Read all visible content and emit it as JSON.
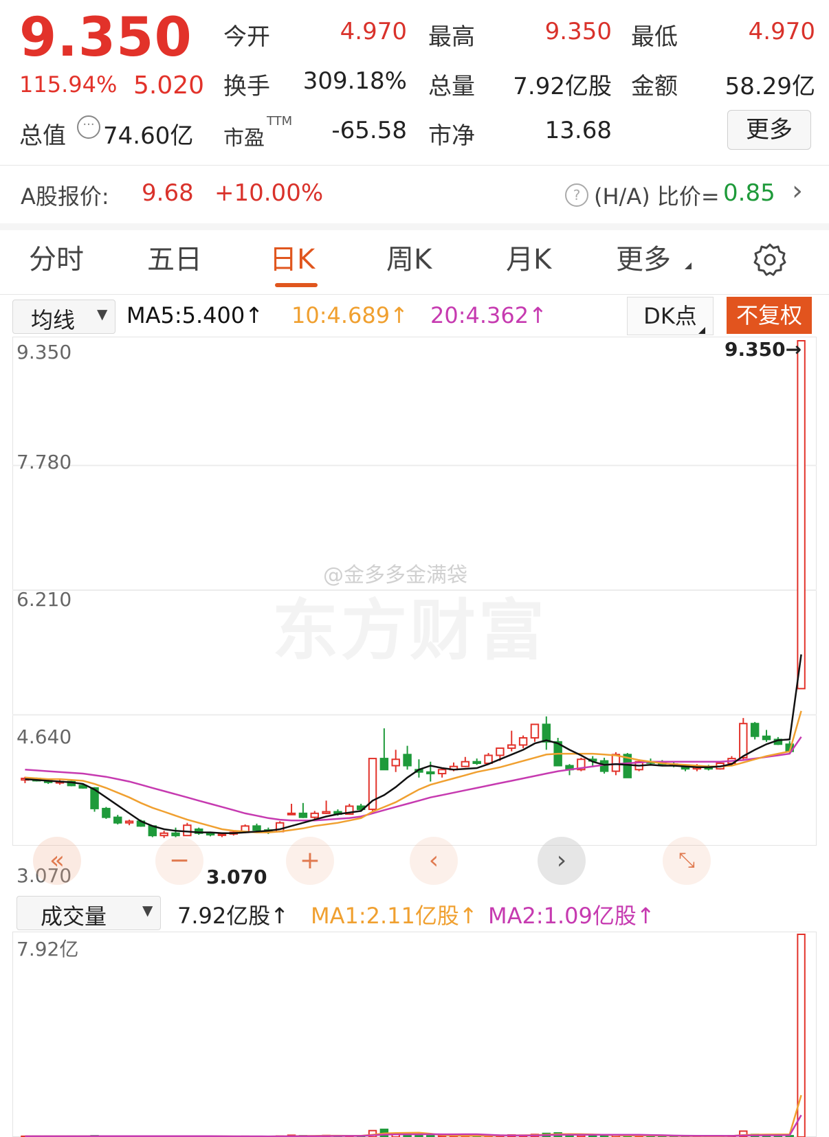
{
  "quote": {
    "price": "9.350",
    "change_pct": "115.94%",
    "change_abs": "5.020",
    "open_label": "今开",
    "open_value": "4.970",
    "high_label": "最高",
    "high_value": "9.350",
    "low_label": "最低",
    "low_value": "4.970",
    "turnover_label": "换手",
    "turnover_value": "309.18%",
    "volume_label": "总量",
    "volume_value": "7.92亿股",
    "amount_label": "金额",
    "amount_value": "58.29亿",
    "mktcap_label": "总值",
    "mktcap_value": "74.60亿",
    "pe_label": "市盈",
    "pe_sup": "TTM",
    "pe_value": "-65.58",
    "pb_label": "市净",
    "pb_value": "13.68",
    "more_label": "更多"
  },
  "ashare": {
    "label": "A股报价:",
    "price": "9.68",
    "change": "+10.00%",
    "ratio_label": "(H/A) 比价=",
    "ratio_value": "0.85"
  },
  "tabs": [
    {
      "label": "分时"
    },
    {
      "label": "五日"
    },
    {
      "label": "日K"
    },
    {
      "label": "周K"
    },
    {
      "label": "月K"
    },
    {
      "label": "更多"
    }
  ],
  "active_tab": "日K",
  "ma_bar": {
    "selector": "均线",
    "ma5": "MA5:5.400↑",
    "ma10": "10:4.689↑",
    "ma20": "20:4.362↑",
    "dk_label": "DK点",
    "adjust_label": "不复权"
  },
  "price_axis": [
    "9.350",
    "7.780",
    "6.210",
    "4.640",
    "3.070"
  ],
  "last_price_marker": "9.350→",
  "min_price_marker": "3.070",
  "watermark": {
    "weibo": "@金多多金满袋",
    "brand": "东方财富"
  },
  "volume_bar": {
    "selector": "成交量",
    "total": "7.92亿股↑",
    "ma1": "MA1:2.11亿股↑",
    "ma2": "MA2:1.09亿股↑",
    "axis_top": "7.92亿"
  },
  "colors": {
    "up": "#e2322a",
    "down": "#1e9a3a",
    "ma5": "#111111",
    "ma10": "#f0a030",
    "ma20": "#c63ab0",
    "accent": "#e0561e"
  },
  "chart_data": {
    "type": "candlestick",
    "ylim": [
      3.07,
      9.35
    ],
    "candles": [
      [
        3.82,
        3.86,
        3.78,
        3.84
      ],
      [
        3.84,
        3.85,
        3.8,
        3.81
      ],
      [
        3.81,
        3.83,
        3.77,
        3.79
      ],
      [
        3.79,
        3.82,
        3.76,
        3.8
      ],
      [
        3.8,
        3.81,
        3.74,
        3.75
      ],
      [
        3.75,
        3.77,
        3.71,
        3.72
      ],
      [
        3.72,
        3.73,
        3.42,
        3.46
      ],
      [
        3.46,
        3.48,
        3.33,
        3.35
      ],
      [
        3.35,
        3.38,
        3.26,
        3.28
      ],
      [
        3.28,
        3.32,
        3.25,
        3.3
      ],
      [
        3.3,
        3.32,
        3.23,
        3.24
      ],
      [
        3.24,
        3.25,
        3.1,
        3.12
      ],
      [
        3.12,
        3.18,
        3.09,
        3.15
      ],
      [
        3.15,
        3.22,
        3.1,
        3.12
      ],
      [
        3.12,
        3.28,
        3.12,
        3.25
      ],
      [
        3.2,
        3.22,
        3.13,
        3.15
      ],
      [
        3.15,
        3.17,
        3.11,
        3.13
      ],
      [
        3.13,
        3.16,
        3.1,
        3.14
      ],
      [
        3.14,
        3.18,
        3.12,
        3.16
      ],
      [
        3.16,
        3.26,
        3.15,
        3.24
      ],
      [
        3.24,
        3.27,
        3.17,
        3.19
      ],
      [
        3.19,
        3.22,
        3.14,
        3.17
      ],
      [
        3.17,
        3.3,
        3.16,
        3.28
      ],
      [
        3.4,
        3.52,
        3.38,
        3.4
      ],
      [
        3.4,
        3.53,
        3.34,
        3.35
      ],
      [
        3.35,
        3.43,
        3.33,
        3.4
      ],
      [
        3.4,
        3.56,
        3.39,
        3.42
      ],
      [
        3.42,
        3.45,
        3.37,
        3.39
      ],
      [
        3.39,
        3.52,
        3.38,
        3.49
      ],
      [
        3.49,
        3.52,
        3.43,
        3.45
      ],
      [
        3.45,
        3.52,
        3.43,
        4.09
      ],
      [
        4.09,
        4.47,
        4.05,
        3.95
      ],
      [
        4.0,
        4.2,
        3.92,
        4.08
      ],
      [
        4.14,
        4.25,
        3.95,
        4.0
      ],
      [
        3.95,
        4.08,
        3.85,
        3.92
      ],
      [
        3.92,
        4.05,
        3.8,
        3.9
      ],
      [
        3.9,
        3.97,
        3.85,
        3.95
      ],
      [
        3.95,
        4.04,
        3.93,
        3.99
      ],
      [
        3.99,
        4.11,
        3.98,
        4.05
      ],
      [
        4.05,
        4.09,
        4.01,
        4.03
      ],
      [
        4.03,
        4.16,
        4.01,
        4.13
      ],
      [
        4.13,
        4.19,
        4.06,
        4.22
      ],
      [
        4.22,
        4.44,
        4.18,
        4.26
      ],
      [
        4.26,
        4.38,
        4.22,
        4.35
      ],
      [
        4.35,
        4.51,
        4.3,
        4.52
      ],
      [
        4.52,
        4.62,
        4.2,
        4.3
      ],
      [
        4.3,
        4.35,
        4.03,
        4.0
      ],
      [
        4.0,
        4.02,
        3.88,
        3.95
      ],
      [
        3.95,
        4.1,
        3.93,
        4.08
      ],
      [
        4.08,
        4.12,
        3.98,
        4.06
      ],
      [
        4.06,
        4.1,
        3.9,
        3.93
      ],
      [
        3.93,
        4.17,
        3.88,
        4.14
      ],
      [
        4.14,
        4.16,
        3.88,
        3.85
      ],
      [
        3.95,
        4.08,
        3.93,
        4.05
      ],
      [
        4.05,
        4.09,
        4.02,
        4.04
      ],
      [
        4.04,
        4.07,
        4.01,
        4.02
      ],
      [
        4.02,
        4.05,
        3.98,
        4.0
      ],
      [
        4.0,
        4.02,
        3.93,
        3.96
      ],
      [
        3.96,
        4.02,
        3.93,
        3.99
      ],
      [
        3.99,
        4.01,
        3.94,
        3.96
      ],
      [
        3.96,
        4.04,
        3.95,
        4.03
      ],
      [
        4.03,
        4.12,
        4.02,
        4.09
      ],
      [
        4.1,
        4.6,
        4.08,
        4.53
      ],
      [
        4.53,
        4.55,
        4.33,
        4.37
      ],
      [
        4.37,
        4.45,
        4.3,
        4.33
      ],
      [
        4.33,
        4.36,
        4.26,
        4.27
      ],
      [
        4.27,
        4.31,
        4.16,
        4.18
      ],
      [
        4.97,
        9.35,
        4.97,
        9.35
      ]
    ],
    "ma5": [
      3.83,
      3.82,
      3.81,
      3.8,
      3.79,
      3.77,
      3.7,
      3.6,
      3.5,
      3.4,
      3.3,
      3.24,
      3.2,
      3.18,
      3.17,
      3.16,
      3.16,
      3.15,
      3.15,
      3.16,
      3.17,
      3.18,
      3.2,
      3.24,
      3.28,
      3.32,
      3.36,
      3.39,
      3.41,
      3.43,
      3.56,
      3.63,
      3.73,
      3.85,
      3.95,
      4.0,
      3.97,
      3.95,
      3.96,
      3.97,
      4.02,
      4.08,
      4.14,
      4.2,
      4.28,
      4.32,
      4.28,
      4.2,
      4.13,
      4.05,
      4.01,
      4.02,
      4.01,
      4.0,
      4.01,
      4.0,
      4.0,
      3.99,
      3.98,
      3.98,
      3.99,
      4.02,
      4.12,
      4.2,
      4.27,
      4.32,
      4.33,
      5.4
    ],
    "ma10": [
      3.85,
      3.84,
      3.83,
      3.83,
      3.82,
      3.81,
      3.77,
      3.72,
      3.66,
      3.6,
      3.53,
      3.47,
      3.42,
      3.37,
      3.32,
      3.28,
      3.24,
      3.2,
      3.18,
      3.17,
      3.16,
      3.16,
      3.17,
      3.19,
      3.21,
      3.24,
      3.26,
      3.28,
      3.31,
      3.34,
      3.42,
      3.48,
      3.54,
      3.62,
      3.7,
      3.76,
      3.8,
      3.84,
      3.88,
      3.92,
      3.95,
      3.98,
      4.02,
      4.06,
      4.1,
      4.14,
      4.15,
      4.15,
      4.15,
      4.15,
      4.14,
      4.13,
      4.1,
      4.07,
      4.05,
      4.03,
      4.02,
      4.01,
      4.0,
      3.99,
      3.99,
      4.0,
      4.04,
      4.08,
      4.12,
      4.15,
      4.18,
      4.689
    ],
    "ma20": [
      3.95,
      3.94,
      3.93,
      3.92,
      3.91,
      3.9,
      3.88,
      3.86,
      3.83,
      3.8,
      3.76,
      3.72,
      3.68,
      3.64,
      3.6,
      3.56,
      3.52,
      3.48,
      3.44,
      3.4,
      3.37,
      3.34,
      3.32,
      3.31,
      3.31,
      3.31,
      3.32,
      3.33,
      3.34,
      3.36,
      3.4,
      3.44,
      3.48,
      3.52,
      3.56,
      3.6,
      3.63,
      3.66,
      3.69,
      3.72,
      3.75,
      3.78,
      3.81,
      3.84,
      3.87,
      3.9,
      3.93,
      3.95,
      3.97,
      3.99,
      4.01,
      4.02,
      4.03,
      4.04,
      4.05,
      4.05,
      4.05,
      4.05,
      4.05,
      4.05,
      4.05,
      4.06,
      4.07,
      4.09,
      4.11,
      4.13,
      4.15,
      4.362
    ],
    "volume": [
      0.03,
      0.03,
      0.03,
      0.03,
      0.03,
      0.03,
      0.05,
      0.04,
      0.03,
      0.03,
      0.03,
      0.04,
      0.03,
      0.03,
      0.04,
      0.02,
      0.02,
      0.02,
      0.02,
      0.03,
      0.02,
      0.02,
      0.04,
      0.07,
      0.05,
      0.04,
      0.06,
      0.04,
      0.05,
      0.04,
      0.25,
      0.3,
      0.12,
      0.1,
      0.06,
      0.05,
      0.04,
      0.05,
      0.06,
      0.05,
      0.06,
      0.07,
      0.08,
      0.07,
      0.1,
      0.14,
      0.16,
      0.09,
      0.06,
      0.05,
      0.05,
      0.08,
      0.07,
      0.05,
      0.04,
      0.04,
      0.03,
      0.04,
      0.04,
      0.03,
      0.04,
      0.05,
      0.23,
      0.1,
      0.06,
      0.05,
      0.05,
      7.92
    ]
  }
}
